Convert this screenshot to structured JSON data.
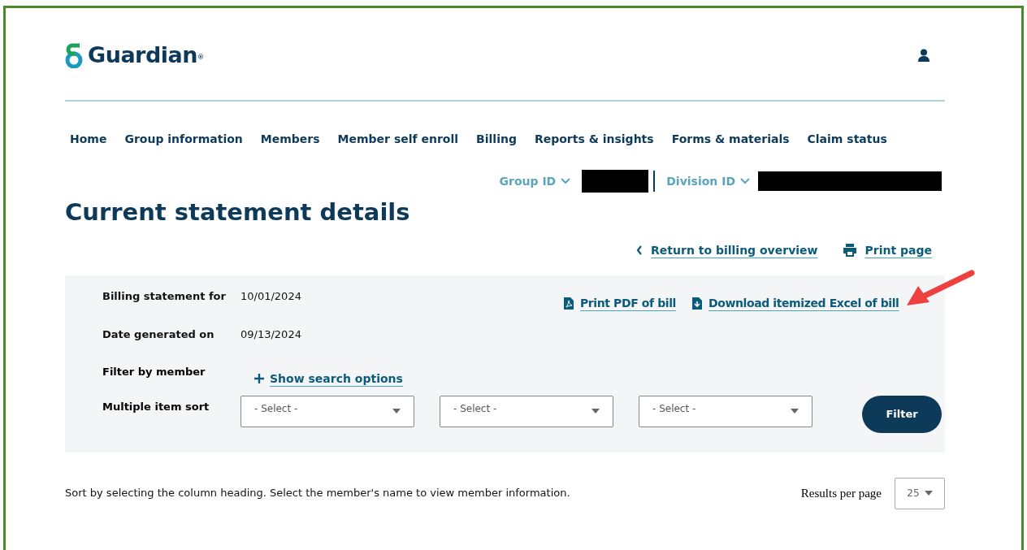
{
  "header": {
    "logo_text": "Guardian",
    "logo_mark": "®"
  },
  "nav": [
    {
      "label": "Home"
    },
    {
      "label": "Group information"
    },
    {
      "label": "Members"
    },
    {
      "label": "Member self enroll"
    },
    {
      "label": "Billing"
    },
    {
      "label": "Reports & insights"
    },
    {
      "label": "Forms & materials"
    },
    {
      "label": "Claim status"
    }
  ],
  "selectors": [
    {
      "label": "Group ID"
    },
    {
      "label": "Division ID"
    }
  ],
  "title": "Current statement details",
  "links": [
    {
      "kind": "back",
      "label": "Return to billing overview"
    },
    {
      "kind": "print",
      "label": "Print page"
    }
  ],
  "statement": {
    "rows": [
      {
        "label": "Billing statement for",
        "value": "10/01/2024"
      },
      {
        "label": "Date generated on",
        "value": "09/13/2024"
      }
    ],
    "files": [
      {
        "kind": "pdf",
        "label": "Print PDF of bill"
      },
      {
        "kind": "download",
        "label": "Download itemized Excel of bill"
      }
    ],
    "filter_label": "Filter by member",
    "search_link": "Show search options",
    "sort_label": "Multiple item sort",
    "sort_selects": [
      {
        "placeholder": "- Select -"
      },
      {
        "placeholder": "- Select -"
      },
      {
        "placeholder": "- Select -"
      }
    ],
    "filter_button": "Filter"
  },
  "hint": "Sort by selecting the column heading. Select the member's name to view member information.",
  "results": {
    "label": "Results per page",
    "value": "25"
  }
}
